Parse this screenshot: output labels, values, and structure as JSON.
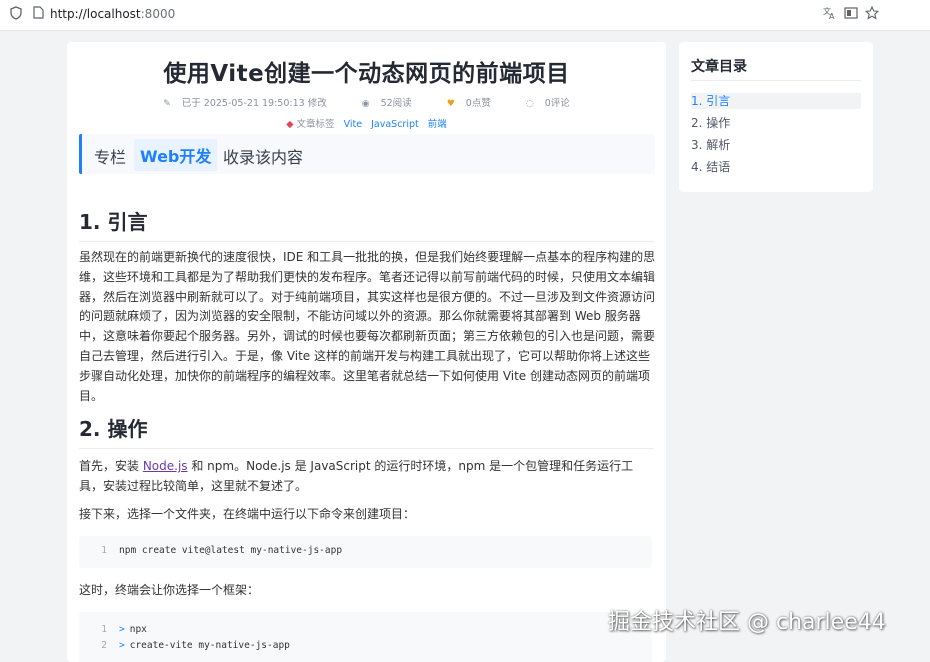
{
  "browser": {
    "url_host": "http://localhost",
    "url_port": ":8000",
    "icons": [
      "shield-icon",
      "page-icon",
      "translate-icon",
      "reader-icon",
      "star-icon"
    ]
  },
  "article": {
    "title": "使用Vite创建一个动态网页的前端项目",
    "meta": {
      "modified": "已于 2025-05-21 19:50:13 修改",
      "reads": "52阅读",
      "likes": "0点赞",
      "comments": "0评论"
    },
    "tags": {
      "label": "文章标签",
      "items": [
        "Vite",
        "JavaScript",
        "前端"
      ]
    },
    "column": {
      "prefix": "专栏",
      "name": "Web开发",
      "suffix": "收录该内容"
    },
    "sections": [
      {
        "heading": "1. 引言",
        "paragraphs": [
          "虽然现在的前端更新换代的速度很快，IDE 和工具一批批的换，但是我们始终要理解一点基本的程序构建的思维，这些环境和工具都是为了帮助我们更快的发布程序。笔者还记得以前写前端代码的时候，只使用文本编辑器，然后在浏览器中刷新就可以了。对于纯前端项目，其实这样也是很方便的。不过一旦涉及到文件资源访问的问题就麻烦了，因为浏览器的安全限制，不能访问域以外的资源。那么你就需要将其部署到 Web 服务器中，这意味着你要起个服务器。另外，调试的时候也要每次都刷新页面；第三方依赖包的引入也是问题，需要自己去管理，然后进行引入。于是，像 Vite 这样的前端开发与构建工具就出现了，它可以帮助你将上述这些步骤自动化处理，加快你的前端程序的编程效率。这里笔者就总结一下如何使用 Vite 创建动态网页的前端项目。"
        ]
      },
      {
        "heading": "2. 操作",
        "intro_before": "首先，安装 ",
        "intro_link": "Node.js",
        "intro_after": " 和 npm。Node.js 是 JavaScript 的运行时环境，npm 是一个包管理和任务运行工具，安装过程比较简单，这里就不复述了。",
        "step2": "接下来，选择一个文件夹，在终端中运行以下命令来创建项目：",
        "code1": [
          {
            "no": "1",
            "text": "npm create vite@latest my-native-js-app"
          }
        ],
        "step3": "这时，终端会让你选择一个框架：",
        "code2": [
          {
            "no": "1",
            "text": "> npx"
          },
          {
            "no": "2",
            "text": "> create-vite my-native-js-app"
          }
        ]
      }
    ]
  },
  "toc": {
    "title": "文章目录",
    "items": [
      "1. 引言",
      "2. 操作",
      "3. 解析",
      "4. 结语"
    ],
    "active_index": 0
  },
  "watermark": "掘金技术社区 @ charlee44",
  "colors": {
    "accent": "#1e80ff",
    "background": "#f2f3f5",
    "link_visited": "#6a3aa8"
  }
}
